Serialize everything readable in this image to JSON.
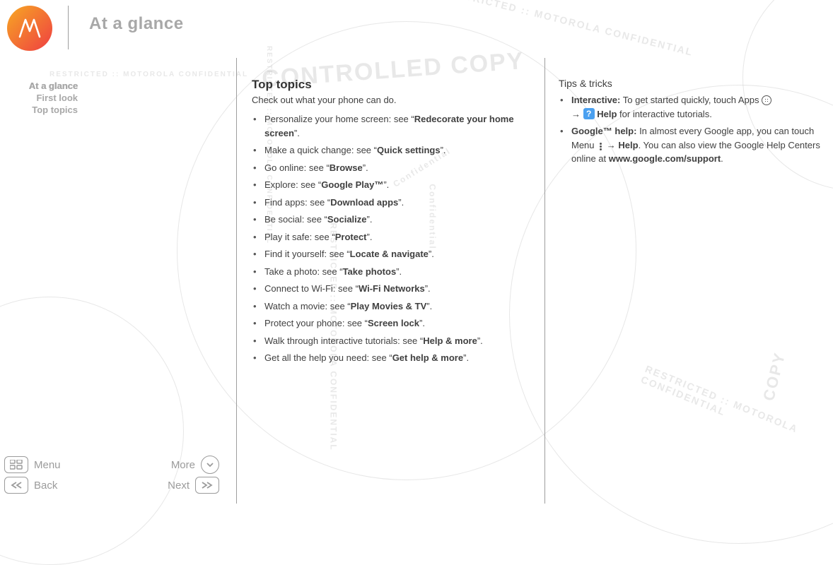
{
  "watermarks": {
    "controlled": "CONTROLLED COPY",
    "restricted": "RESTRICTED :: MOTOROLA CONFIDENTIAL",
    "confidential": "Confidential",
    "copy": "COPY"
  },
  "header": {
    "title": "At a glance"
  },
  "nav": {
    "items": [
      {
        "label": "At a glance",
        "active": true
      },
      {
        "label": "First look",
        "active": false
      },
      {
        "label": "Top topics",
        "active": false
      }
    ]
  },
  "footer": {
    "menu": "Menu",
    "more": "More",
    "back": "Back",
    "next": "Next"
  },
  "main": {
    "heading": "Top topics",
    "subtitle": "Check out what your phone can do.",
    "items": [
      {
        "pre": "Personalize your home screen: see “",
        "link": "Redecorate your home screen",
        "post": "”."
      },
      {
        "pre": "Make a quick change: see “",
        "link": "Quick settings",
        "post": "”."
      },
      {
        "pre": "Go online: see “",
        "link": "Browse",
        "post": "”."
      },
      {
        "pre": "Explore: see “",
        "link": "Google Play™",
        "post": "”."
      },
      {
        "pre": "Find apps: see “",
        "link": "Download apps",
        "post": "”."
      },
      {
        "pre": "Be social: see “",
        "link": "Socialize",
        "post": "”."
      },
      {
        "pre": "Play it safe: see “",
        "link": "Protect",
        "post": "”."
      },
      {
        "pre": "Find it yourself: see “",
        "link": "Locate & navigate",
        "post": "”."
      },
      {
        "pre": "Take a photo: see “",
        "link": "Take photos",
        "post": "”."
      },
      {
        "pre": "Connect to Wi-Fi: see “",
        "link": "Wi-Fi Networks",
        "post": "”."
      },
      {
        "pre": "Watch a movie: see “",
        "link": "Play Movies & TV",
        "post": "”."
      },
      {
        "pre": "Protect your phone: see “",
        "link": "Screen lock",
        "post": "”."
      },
      {
        "pre": "Walk through interactive tutorials: see “",
        "link": "Help & more",
        "post": "”."
      },
      {
        "pre": "Get all the help you need: see “",
        "link": "Get help & more",
        "post": "”."
      }
    ]
  },
  "tips": {
    "heading": "Tips & tricks",
    "interactive": {
      "label": "Interactive:",
      "t1": " To get started quickly, touch Apps ",
      "arrow": "→",
      "help_bold": " Help",
      "t2": " for interactive tutorials."
    },
    "google": {
      "label": "Google™ help:",
      "t1": " In almost every Google app, you can touch Menu ",
      "arrow": "→",
      "help_bold": " Help",
      "t2": ". You can also view the Google Help Centers online at ",
      "url": "www.google.com/support",
      "t3": "."
    }
  }
}
